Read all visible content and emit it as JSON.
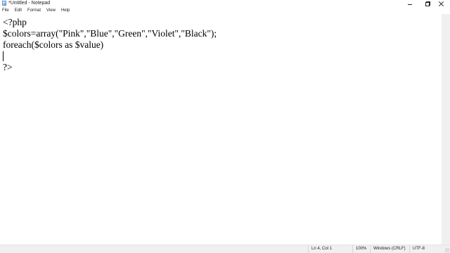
{
  "window": {
    "title": "*Untitled - Notepad",
    "icon": "notepad-icon",
    "controls": {
      "minimize": "minimize-icon",
      "maximize": "restore-icon",
      "close": "close-icon"
    }
  },
  "menu": {
    "items": [
      {
        "label": "File"
      },
      {
        "label": "Edit"
      },
      {
        "label": "Format"
      },
      {
        "label": "View"
      },
      {
        "label": "Help"
      }
    ]
  },
  "editor": {
    "lines": [
      "<?php",
      "$colors=array(\"Pink\",\"Blue\",\"Green\",\"Violet\",\"Black\");",
      "foreach($colors as $value)",
      "",
      "?>"
    ],
    "caret_line": 4
  },
  "status": {
    "position": "Ln 4, Col 1",
    "zoom": "100%",
    "line_ending": "Windows (CRLF)",
    "encoding": "UTF-8"
  },
  "colors": {
    "background": "#ffffff",
    "chrome": "#f0f0f0",
    "text": "#000000"
  }
}
